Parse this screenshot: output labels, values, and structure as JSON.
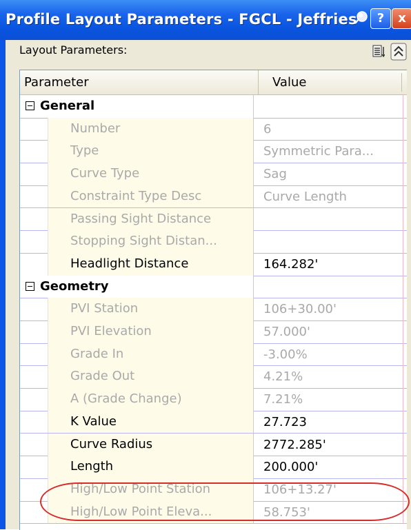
{
  "window": {
    "title": "Profile Layout Parameters - FGCL - Jeffries R..."
  },
  "title_buttons": {
    "help_label": "?",
    "close_label": "x"
  },
  "panel": {
    "label": "Layout Parameters:"
  },
  "grid": {
    "columns": [
      "Parameter",
      "Value"
    ],
    "groups": [
      {
        "name": "General",
        "rows": [
          {
            "param": "Number",
            "value": "6",
            "state": "disabled"
          },
          {
            "param": "Type",
            "value": "Symmetric Para...",
            "state": "disabled"
          },
          {
            "param": "Curve Type",
            "value": "Sag",
            "state": "disabled"
          },
          {
            "param": "Constraint Type Desc",
            "value": "Curve Length",
            "state": "disabled"
          },
          {
            "param": "Passing Sight Distance",
            "value": "",
            "state": "disabled"
          },
          {
            "param": "Stopping Sight Distan...",
            "value": "",
            "state": "disabled"
          },
          {
            "param": "Headlight Distance",
            "value": "164.282'",
            "state": "enabled"
          }
        ]
      },
      {
        "name": "Geometry",
        "rows": [
          {
            "param": "PVI Station",
            "value": "106+30.00'",
            "state": "disabled"
          },
          {
            "param": "PVI Elevation",
            "value": "57.000'",
            "state": "disabled"
          },
          {
            "param": "Grade In",
            "value": "-3.00%",
            "state": "disabled"
          },
          {
            "param": "Grade Out",
            "value": "4.21%",
            "state": "disabled"
          },
          {
            "param": "A (Grade Change)",
            "value": "7.21%",
            "state": "disabled"
          },
          {
            "param": "K Value",
            "value": "27.723",
            "state": "enabled"
          },
          {
            "param": "Curve Radius",
            "value": "2772.285'",
            "state": "enabled"
          },
          {
            "param": "Length",
            "value": "200.000'",
            "state": "enabled"
          },
          {
            "param": "High/Low Point Station",
            "value": "106+13.27'",
            "state": "disabled"
          },
          {
            "param": "High/Low Point Eleva...",
            "value": "58.753'",
            "state": "disabled"
          }
        ]
      }
    ]
  },
  "colors": {
    "titlebar": "#0a55df",
    "highlight_ellipse": "#d92b2b",
    "param_cell_bg": "#fefce9",
    "disabled_text": "#a9a9a9"
  },
  "icons": [
    "pin-icon",
    "help-icon",
    "close-icon",
    "list-view-icon",
    "collapse-up-icon",
    "group-collapse-icon"
  ]
}
